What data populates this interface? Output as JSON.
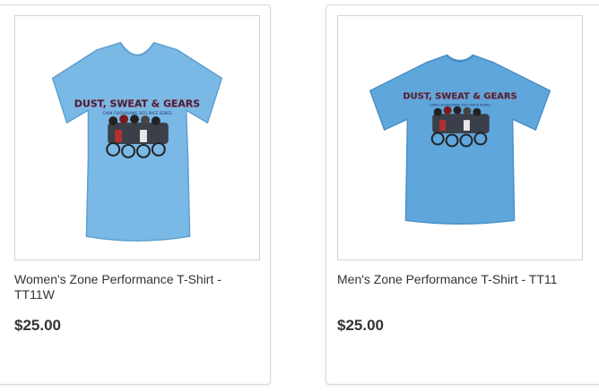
{
  "products": [
    {
      "title": "Women's Zone Performance T-Shirt - TT11W",
      "price": "$25.00",
      "image": {
        "shirt_color": "#7ab8e6",
        "graphic_title": "DUST, SWEAT & GEARS",
        "graphic_subtitle": "CARA CHICKASAWS 2021 RACE SERIES"
      }
    },
    {
      "title": "Men's Zone Performance T-Shirt - TT11",
      "price": "$25.00",
      "image": {
        "shirt_color": "#5ea6dc",
        "graphic_title": "DUST, SWEAT & GEARS",
        "graphic_subtitle": "CARA CHICKASAWS 2021 RACE SERIES"
      }
    }
  ]
}
